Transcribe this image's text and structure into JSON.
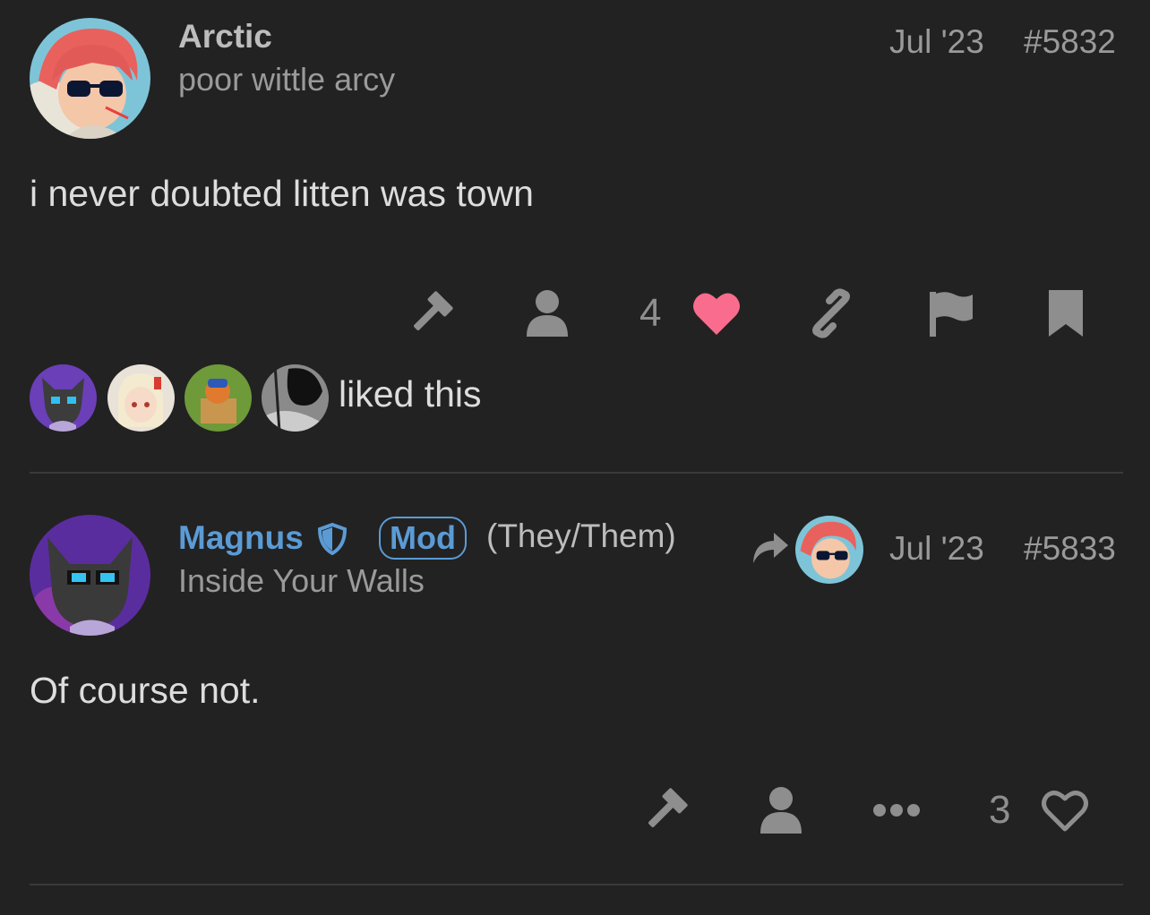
{
  "posts": [
    {
      "username": "Arctic",
      "user_title": "poor wittle arcy",
      "date": "Jul '23",
      "post_number": "#5832",
      "body": "i never doubted litten was town",
      "like_count": "4",
      "liked": true,
      "liked_by_text": "liked this",
      "liked_by_avatars": [
        "wolf-avatar",
        "anime-girl-avatar",
        "cat-box-avatar",
        "monochrome-avatar"
      ]
    },
    {
      "username": "Magnus",
      "mod_badge": "Mod",
      "pronouns": "(They/Them)",
      "user_title": "Inside Your Walls",
      "date": "Jul '23",
      "post_number": "#5833",
      "body": "Of course not.",
      "like_count": "3",
      "liked": false
    }
  ],
  "colors": {
    "background": "#222222",
    "like_active": "#fa6c8d",
    "mod_accent": "#5b9bd5",
    "icon": "#8e8e8e"
  }
}
